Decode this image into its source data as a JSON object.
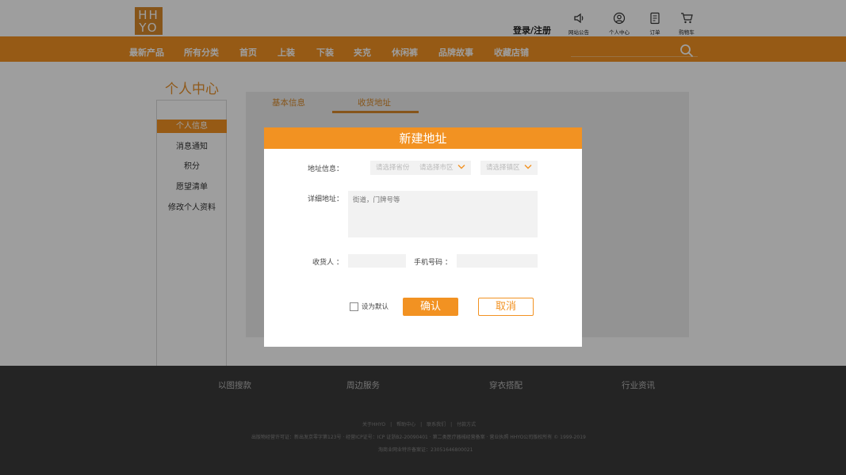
{
  "header": {
    "logo_text": "HHYO",
    "login_label": "登录/注册",
    "icons": [
      {
        "name": "announcement-icon",
        "label": "网站公告"
      },
      {
        "name": "user-icon",
        "label": "个人中心"
      },
      {
        "name": "order-icon",
        "label": "订单"
      },
      {
        "name": "cart-icon",
        "label": "购物车"
      }
    ]
  },
  "nav": {
    "items": [
      "最新产品",
      "所有分类",
      "首页",
      "上装",
      "下装",
      "夹克",
      "休闲裤",
      "品牌故事",
      "收藏店铺"
    ]
  },
  "sidebar": {
    "title": "个人中心",
    "items": [
      "个人信息",
      "消息通知",
      "积分",
      "愿望清单",
      "修改个人资料"
    ],
    "active_index": 0
  },
  "tabs": {
    "items": [
      "基本信息",
      "收货地址"
    ],
    "active_index": 1
  },
  "modal": {
    "title": "新建地址",
    "address_label": "地址信息：",
    "province_placeholder": "请选择省份",
    "city_placeholder": "请选择市区",
    "district_placeholder": "请选择镇区",
    "detail_label": "详细地址：",
    "detail_placeholder": "街道，门牌号等",
    "receiver_label": "收货人 ：",
    "phone_label": "手机号码 ：",
    "default_label": "设为默认",
    "default_checked": false,
    "confirm_label": "确认",
    "cancel_label": "取消"
  },
  "footer": {
    "links": [
      "以图搜款",
      "周边服务",
      "穿衣搭配",
      "行业资讯"
    ],
    "small_links": "关于HHYO　|　帮助中心　|　联系我们　|　付款方式",
    "license_line": "出版物经营许可证：新出发京零字第123号 · 经营ICP证号：ICP 证浙B2-20090401 · 第二类医疗器械经营备案 · 营业执照 HHYO公司版权所有 © 1999-2019",
    "record_line": "淘商业网业特许备案证：23051646800021"
  },
  "colors": {
    "accent": "#f29222",
    "accent_dark": "#d98a2b",
    "footer_bg": "#3a3a3a"
  }
}
